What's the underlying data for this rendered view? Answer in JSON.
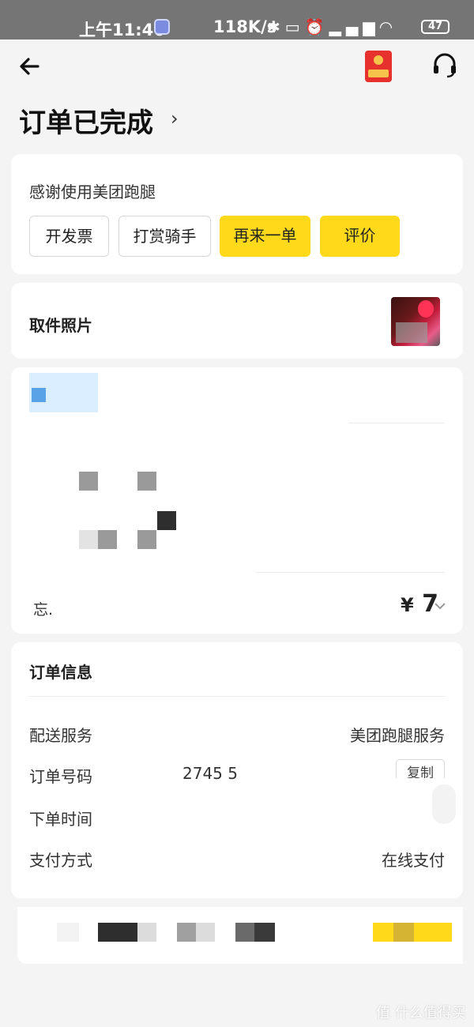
{
  "status_bar": {
    "time": "上午11:46",
    "network_speed": "118K/s",
    "battery": "47",
    "icons": [
      "bluetooth-icon",
      "toggle-icon",
      "alarm-icon",
      "signal-icon",
      "signal-hd-icon",
      "wifi-icon"
    ]
  },
  "nav": {
    "back_icon": "back-arrow-icon",
    "red_packet_icon": "red-packet-icon",
    "support_icon": "headset-icon"
  },
  "order_status": {
    "title": "订单已完成",
    "chevron": "›"
  },
  "thanks_card": {
    "message": "感谢使用美团跑腿",
    "buttons": [
      {
        "label": "开发票",
        "style": "outline"
      },
      {
        "label": "打赏骑手",
        "style": "outline"
      },
      {
        "label": "再来一单",
        "style": "yellow"
      },
      {
        "label": "评价",
        "style": "yellow"
      }
    ]
  },
  "pickup_photo": {
    "label": "取件照片"
  },
  "order_summary": {
    "total_label": "忘.",
    "currency": "¥",
    "price": "7"
  },
  "order_info": {
    "title": "订单信息",
    "rows": [
      {
        "label": "配送服务",
        "value": "美团跑腿服务"
      },
      {
        "label": "订单号码",
        "value": "2745 5",
        "action": "复制"
      },
      {
        "label": "下单时间",
        "value": ""
      },
      {
        "label": "支付方式",
        "value": "在线支付"
      }
    ]
  },
  "watermark": {
    "text": "值 什么值得买"
  },
  "colors": {
    "accent_yellow": "#ffd91a",
    "status_bar": "#757575",
    "background": "#f4f4f4"
  }
}
